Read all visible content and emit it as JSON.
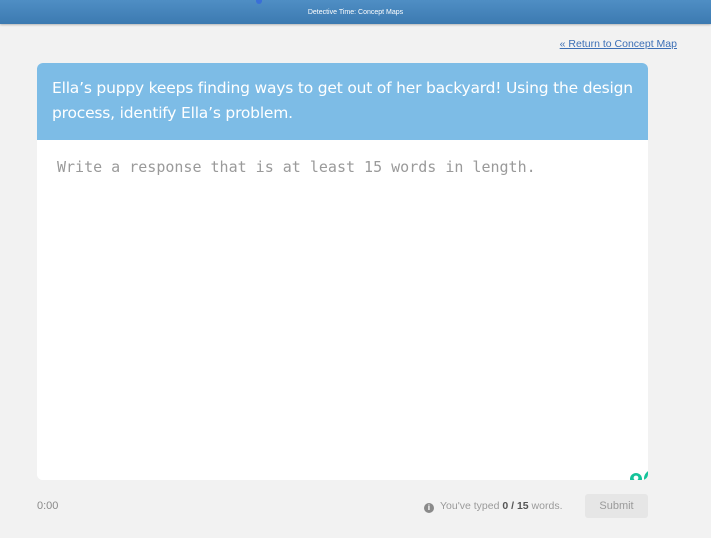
{
  "header": {
    "title": "Detective Time: Concept Maps"
  },
  "nav": {
    "return_link": "« Return to Concept Map"
  },
  "prompt": {
    "text": "Ella’s puppy keeps finding ways to get out of her backyard! Using the design process, identify Ella’s problem."
  },
  "response": {
    "placeholder": "Write a response that is at least 15 words in length.",
    "value": ""
  },
  "footer": {
    "timer": "0:00",
    "count_prefix": "You've typed ",
    "count_current": "0",
    "count_sep": " / ",
    "count_required": "15",
    "count_suffix": " words.",
    "submit_label": "Submit"
  },
  "icons": {
    "info": "info-icon",
    "grammarly_bulb": "lightbulb-icon",
    "grammarly_logo": "grammarly-g-icon"
  },
  "colors": {
    "topbar": "#3c7ab1",
    "prompt_bg": "#7dbce6",
    "link": "#3c6fb6",
    "grammarly": "#15c39a"
  }
}
